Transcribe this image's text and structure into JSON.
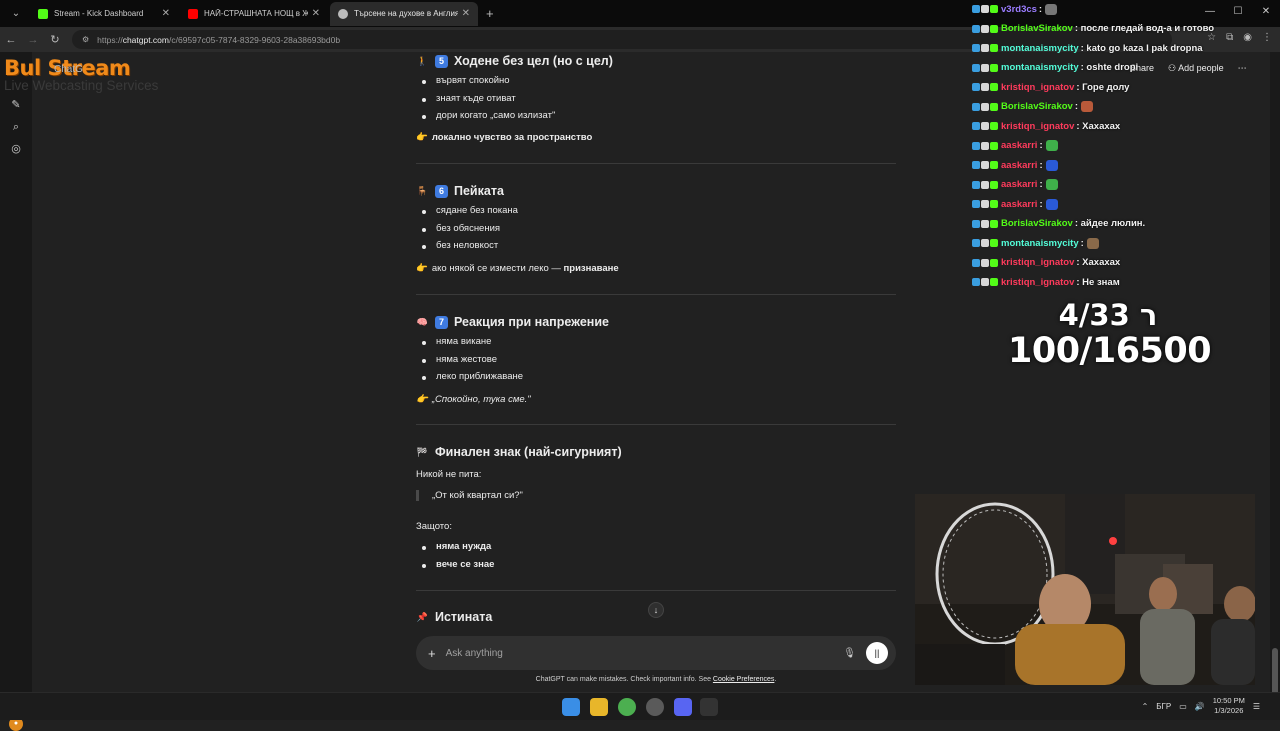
{
  "browser": {
    "tabs": [
      {
        "title": "Stream - Kick Dashboard",
        "favicon_color": "#53fc18"
      },
      {
        "title": "НАЙ-СТРАШНАТА НОЩ в Жив",
        "favicon_color": "#ff0000"
      },
      {
        "title": "Търсене на духове в Англия",
        "favicon_color": "#bbbbbb"
      }
    ],
    "url_host": "chatgpt.com",
    "url_path": "/c/69597c05-7874-8329-9603-28a38693bd0b",
    "url_scheme": "https://"
  },
  "overlay_logo": {
    "big": "Bul Stream",
    "small": "Live Webcasting Services",
    "underlay_text": "ChatG"
  },
  "header_actions": {
    "share": "Share",
    "add_people": "Add people"
  },
  "sections": [
    {
      "icon": "walking-person-icon",
      "num": "5",
      "title": "Ходене без цел (но с цел)",
      "bullets": [
        "вървят спокойно",
        "знаят къде отиват",
        "дори когато „само излизат\""
      ],
      "pointer": "локално чувство за пространство",
      "pointer_bold": true
    },
    {
      "icon": "chair-icon",
      "num": "6",
      "title": "Пейката",
      "bullets": [
        "сядане без покана",
        "без обяснения",
        "без неловкост"
      ],
      "pointer_pre": "ако някой се измести леко — ",
      "pointer_bold_part": "признаване"
    },
    {
      "icon": "brain-icon",
      "num": "7",
      "title": "Реакция при напрежение",
      "bullets": [
        "няма викане",
        "няма жестове",
        "леко приближаване"
      ],
      "pointer": "„Спокойно, тука сме.\""
    },
    {
      "icon": "checkered-flag-icon",
      "title": "Финален знак (най-сигурният)",
      "intro": "Никой не пита:",
      "quote": "„От кой квартал си?\"",
      "because": "Защото:",
      "bullets": [
        "няма нужда",
        "вече се знае"
      ]
    },
    {
      "icon": "pin-icon",
      "title": "Истината"
    }
  ],
  "composer": {
    "placeholder": "Ask anything"
  },
  "disclaimer": {
    "text": "ChatGPT can make mistakes. Check important info. See ",
    "link": "Cookie Preferences",
    "end": "."
  },
  "stream_chat": [
    {
      "user": "v3rd3cs",
      "color": "#9b7dff",
      "msg": ":",
      "emote": "#777777"
    },
    {
      "user": "BorislavSirakov",
      "color": "#53fc18",
      "msg": ": после гледай вод-а и готово"
    },
    {
      "user": "montanaismycity",
      "color": "#53fcd8",
      "msg": ": kato go kaza I pak dropna"
    },
    {
      "user": "montanaismycity",
      "color": "#53fcd8",
      "msg": ": oshte dropi"
    },
    {
      "user": "kristiqn_ignatov",
      "color": "#ff3b5c",
      "msg": ": Горе долу"
    },
    {
      "user": "BorislavSirakov",
      "color": "#53fc18",
      "msg": ":",
      "emote": "#b85a3a"
    },
    {
      "user": "kristiqn_ignatov",
      "color": "#ff3b5c",
      "msg": ": Хахахах"
    },
    {
      "user": "aaskarri",
      "color": "#ff3b5c",
      "msg": ":",
      "emote": "#3fb04a"
    },
    {
      "user": "aaskarri",
      "color": "#ff3b5c",
      "msg": ":",
      "emote": "#2a5ad8"
    },
    {
      "user": "aaskarri",
      "color": "#ff3b5c",
      "msg": ":",
      "emote": "#3fb04a"
    },
    {
      "user": "aaskarri",
      "color": "#ff3b5c",
      "msg": ":",
      "emote": "#2a5ad8"
    },
    {
      "user": "BorislavSirakov",
      "color": "#53fc18",
      "msg": ": айдее люлин."
    },
    {
      "user": "montanaismycity",
      "color": "#53fcd8",
      "msg": ":",
      "emote": "#8a6a4a"
    },
    {
      "user": "kristiqn_ignatov",
      "color": "#ff3b5c",
      "msg": ": Хахахах"
    },
    {
      "user": "kristiqn_ignatov",
      "color": "#ff3b5c",
      "msg": ": Не знам"
    }
  ],
  "counter": {
    "line1": "ר 4/33",
    "line2": "100/16500"
  },
  "taskbar": {
    "lang": "БГР",
    "time": "10:50 PM",
    "date": "1/3/2026"
  }
}
